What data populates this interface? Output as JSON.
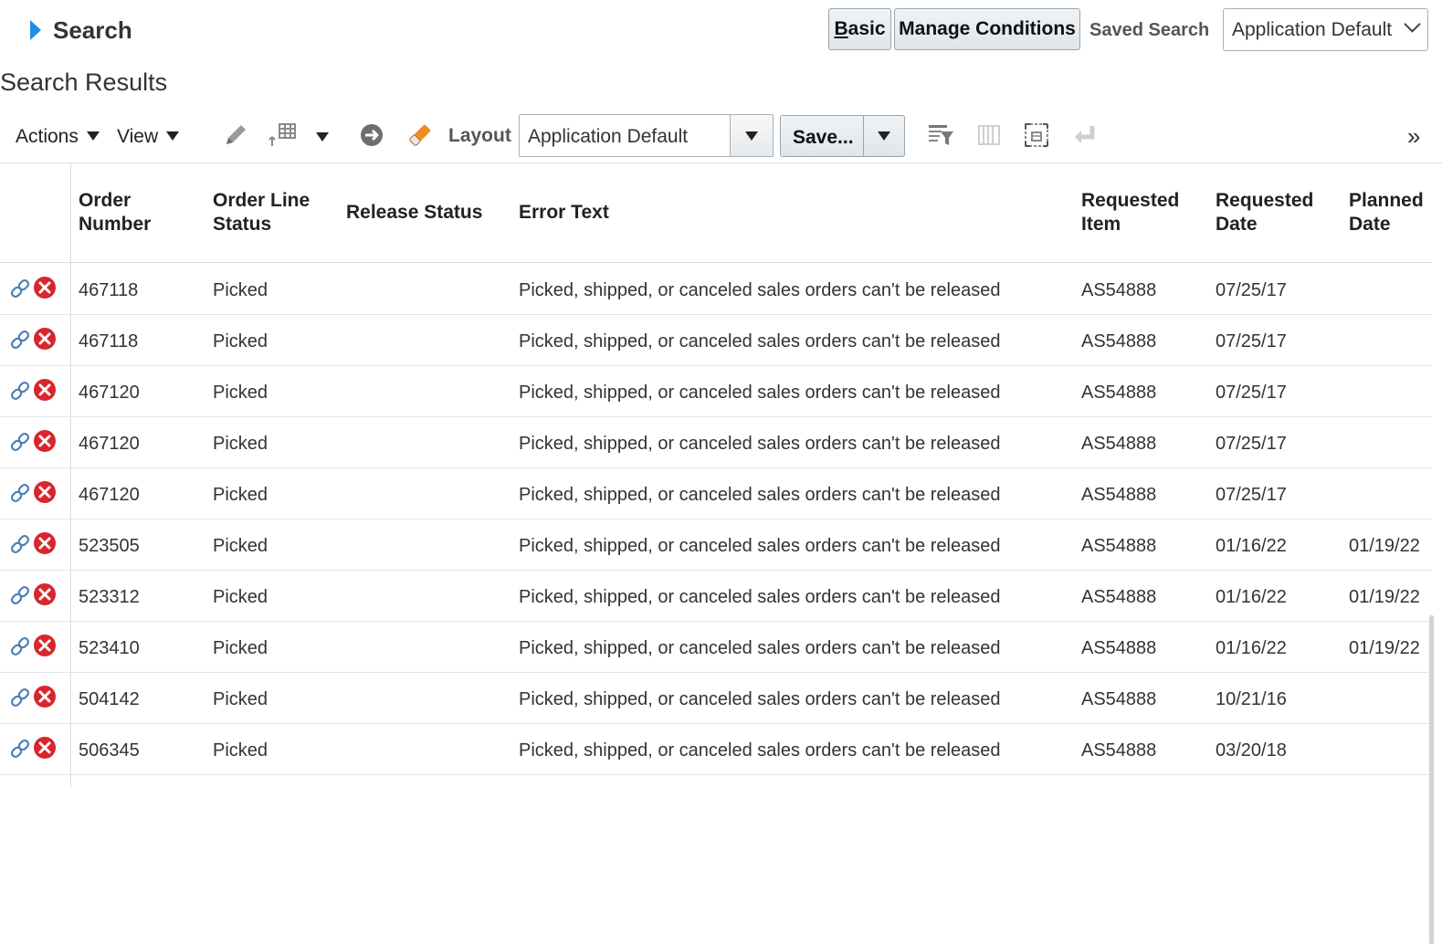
{
  "search": {
    "title": "Search",
    "basic_button_first": "B",
    "basic_button_rest": "asic",
    "manage_conditions_button": "Manage Conditions",
    "saved_search_label": "Saved Search",
    "saved_search_value": "Application Default"
  },
  "results": {
    "title": "Search Results"
  },
  "toolbar": {
    "actions_label": "Actions",
    "view_label": "View",
    "layout_label": "Layout",
    "layout_value": "Application Default",
    "save_label": "Save...",
    "overflow_glyph": "»"
  },
  "table": {
    "columns": {
      "order_number_1": "Order",
      "order_number_2": "Number",
      "order_line_status_1": "Order Line",
      "order_line_status_2": "Status",
      "release_status": "Release Status",
      "error_text": "Error Text",
      "requested_item_1": "Requested",
      "requested_item_2": "Item",
      "requested_date_1": "Requested",
      "requested_date_2": "Date",
      "planned_date_1": "Planned",
      "planned_date_2": "Date"
    },
    "rows": [
      {
        "order": "467118",
        "status": "Picked",
        "release": "",
        "error": "Picked, shipped, or canceled sales orders can't be released",
        "item": "AS54888",
        "req_date": "07/25/17",
        "planned": ""
      },
      {
        "order": "467118",
        "status": "Picked",
        "release": "",
        "error": "Picked, shipped, or canceled sales orders can't be released",
        "item": "AS54888",
        "req_date": "07/25/17",
        "planned": ""
      },
      {
        "order": "467120",
        "status": "Picked",
        "release": "",
        "error": "Picked, shipped, or canceled sales orders can't be released",
        "item": "AS54888",
        "req_date": "07/25/17",
        "planned": ""
      },
      {
        "order": "467120",
        "status": "Picked",
        "release": "",
        "error": "Picked, shipped, or canceled sales orders can't be released",
        "item": "AS54888",
        "req_date": "07/25/17",
        "planned": ""
      },
      {
        "order": "467120",
        "status": "Picked",
        "release": "",
        "error": "Picked, shipped, or canceled sales orders can't be released",
        "item": "AS54888",
        "req_date": "07/25/17",
        "planned": ""
      },
      {
        "order": "523505",
        "status": "Picked",
        "release": "",
        "error": "Picked, shipped, or canceled sales orders can't be released",
        "item": "AS54888",
        "req_date": "01/16/22",
        "planned": "01/19/22"
      },
      {
        "order": "523312",
        "status": "Picked",
        "release": "",
        "error": "Picked, shipped, or canceled sales orders can't be released",
        "item": "AS54888",
        "req_date": "01/16/22",
        "planned": "01/19/22"
      },
      {
        "order": "523410",
        "status": "Picked",
        "release": "",
        "error": "Picked, shipped, or canceled sales orders can't be released",
        "item": "AS54888",
        "req_date": "01/16/22",
        "planned": "01/19/22"
      },
      {
        "order": "504142",
        "status": "Picked",
        "release": "",
        "error": "Picked, shipped, or canceled sales orders can't be released",
        "item": "AS54888",
        "req_date": "10/21/16",
        "planned": ""
      },
      {
        "order": "506345",
        "status": "Picked",
        "release": "",
        "error": "Picked, shipped, or canceled sales orders can't be released",
        "item": "AS54888",
        "req_date": "03/20/18",
        "planned": ""
      }
    ]
  },
  "colors": {
    "disclosure": "#1f8ee8",
    "error_icon": "#d9252d",
    "link_icon": "#4a7fb5"
  }
}
